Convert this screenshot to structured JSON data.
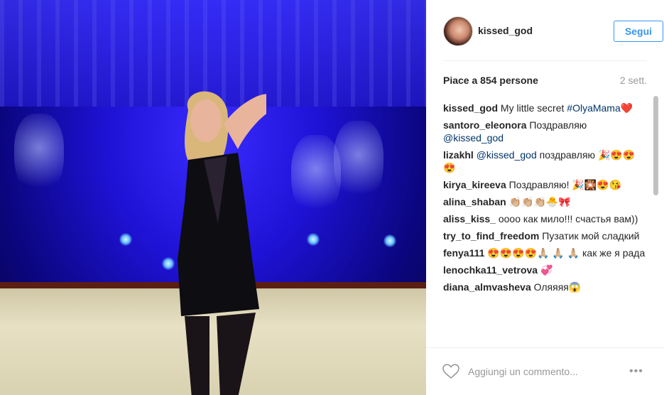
{
  "post": {
    "username": "kissed_god",
    "follow_label": "Segui",
    "likes": "Piace a 854 persone",
    "time_ago": "2 sett."
  },
  "comments": [
    {
      "user": "kissed_god",
      "text": "My little secret ",
      "tag": "#OlyaMama",
      "after": "❤️"
    },
    {
      "user": "santoro_eleonora",
      "text": "Поздравляю ",
      "tag": "@kissed_god",
      "after": ""
    },
    {
      "user": "lizakhl",
      "text": "",
      "tag": "@kissed_god",
      "after": " поздравляю 🎉😍😍😍"
    },
    {
      "user": "kirya_kireeva",
      "text": "Поздравляю! 🎉🎇😍😘",
      "tag": "",
      "after": ""
    },
    {
      "user": "alina_shaban",
      "text": "👏🏼👏🏼👏🏼🐣🎀",
      "tag": "",
      "after": ""
    },
    {
      "user": "aliss_kiss_",
      "text": "оооо как мило!!! счастья вам))",
      "tag": "",
      "after": ""
    },
    {
      "user": "try_to_find_freedom",
      "text": "Пузатик мой сладкий",
      "tag": "",
      "after": ""
    },
    {
      "user": "fenya111",
      "text": "😍😍😍😍🙏🏼 🙏🏼 🙏🏼 как же я рада",
      "tag": "",
      "after": ""
    },
    {
      "user": "lenochka11_vetrova",
      "text": "💞",
      "tag": "",
      "after": ""
    },
    {
      "user": "diana_almvasheva",
      "text": "Оляяяя😱",
      "tag": "",
      "after": ""
    }
  ],
  "footer": {
    "add_comment_placeholder": "Aggiungi un commento...",
    "heart_icon": "heart-outline-icon",
    "more_icon": "more-options-icon"
  },
  "colors": {
    "link_blue": "#3897f0",
    "tag_blue": "#003569",
    "photo_blue": "#1f12d6"
  }
}
